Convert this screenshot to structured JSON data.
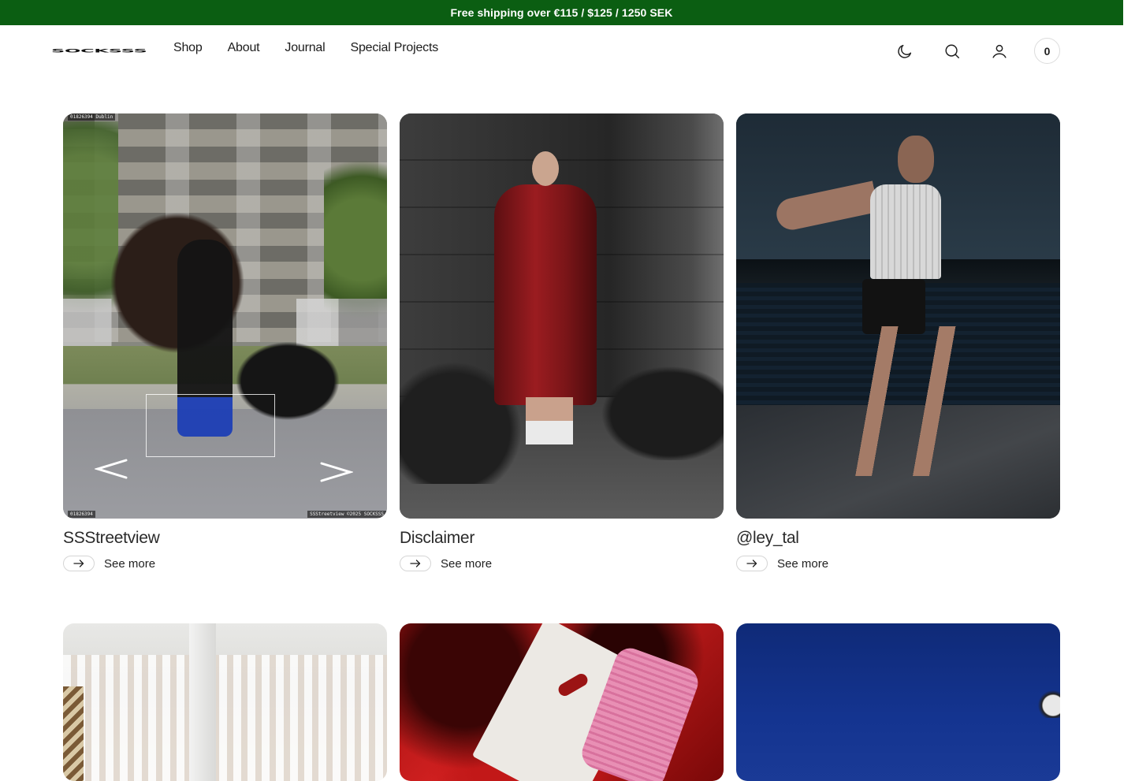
{
  "banner": {
    "text": "Free shipping over €115 / $125 / 1250 SEK",
    "bg_color": "#0b5e12"
  },
  "header": {
    "logo_text": "SOCKSSS",
    "nav": [
      {
        "label": "Shop"
      },
      {
        "label": "About"
      },
      {
        "label": "Journal"
      },
      {
        "label": "Special Projects"
      }
    ],
    "icons": {
      "theme": "moon-icon",
      "search": "search-icon",
      "account": "user-icon",
      "cart": "cart-count-icon"
    },
    "cart_count": "0"
  },
  "cards": [
    {
      "title": "SSStreetview",
      "link_label": "See more",
      "image_tags": {
        "top_left": "01826394 Dublin",
        "bottom_left": "01826394",
        "bottom_right": "SSStreetview ©2025 SOCKSSS"
      }
    },
    {
      "title": "Disclaimer",
      "link_label": "See more"
    },
    {
      "title": "@ley_tal",
      "link_label": "See more"
    },
    {
      "title": "",
      "link_label": ""
    },
    {
      "title": "",
      "link_label": ""
    },
    {
      "title": "",
      "link_label": ""
    }
  ]
}
